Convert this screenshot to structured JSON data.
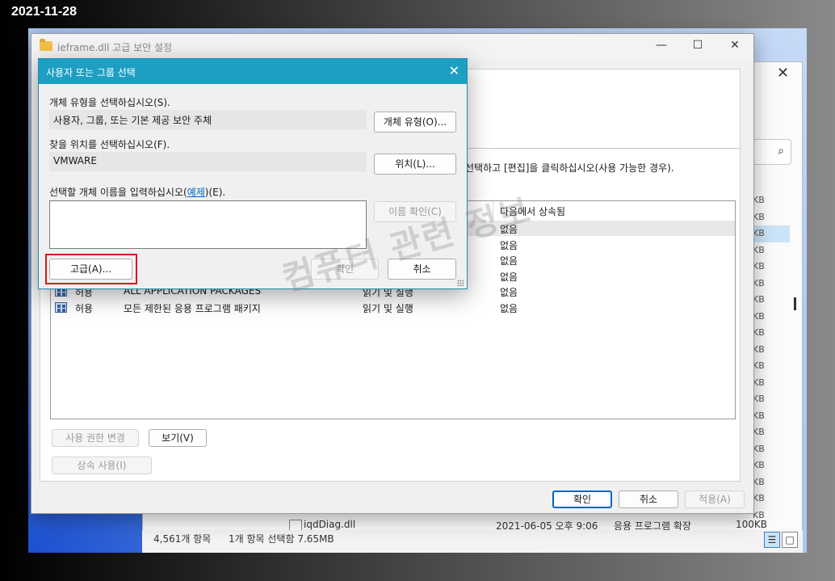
{
  "date_stamp": "2021-11-28",
  "explorer": {
    "size_column": [
      "KB",
      "KB",
      "KB",
      "KB",
      "KB",
      "KB",
      "KB",
      "KB",
      "KB",
      "KB",
      "KB",
      "KB",
      "KB",
      "KB",
      "KB",
      "KB",
      "KB",
      "KB",
      "KB",
      "KB"
    ],
    "last_row": {
      "name": "iqdDiag.dll",
      "date": "2021-06-05 오후 9:06",
      "type": "응용 프로그램 확장",
      "size": "100KB"
    },
    "status_count": "4,561개 항목",
    "status_selection": "1개 항목 선택함 7.65MB",
    "search_icon": "search-icon"
  },
  "security_window": {
    "title": "ieframe.dll 고급 보안 설정",
    "hint": "선택하고 [편집]을 클릭하십시오(사용 가능한 경우).",
    "table": {
      "inherited_header": "다음에서 상속됨",
      "rows": [
        {
          "type": "",
          "principal": "",
          "access": "",
          "inherited": "없음",
          "selected": true
        },
        {
          "type": "",
          "principal": "",
          "access": "",
          "inherited": "없음"
        },
        {
          "type": "",
          "principal": "",
          "access": "",
          "inherited": "없음"
        },
        {
          "type": "",
          "principal": "",
          "access": "",
          "inherited": "없음"
        },
        {
          "type": "허용",
          "principal": "ALL APPLICATION PACKAGES",
          "access": "읽기 및 실행",
          "inherited": "없음"
        },
        {
          "type": "허용",
          "principal": "모든 제한된 응용 프로그램 패키지",
          "access": "읽기 및 실행",
          "inherited": "없음"
        }
      ]
    },
    "buttons": {
      "change_permissions": "사용 권한 변경",
      "view": "보기(V)",
      "enable_inheritance": "상속 사용(I)",
      "ok": "확인",
      "cancel": "취소",
      "apply": "적용(A)"
    }
  },
  "select_dialog": {
    "title": "사용자 또는 그룹 선택",
    "object_type_label": "개체 유형을 선택하십시오(S).",
    "object_type_value": "사용자, 그룹, 또는 기본 제공 보안 주체",
    "object_type_button": "개체 유형(O)...",
    "location_label": "찾을 위치를 선택하십시오(F).",
    "location_value": "VMWARE",
    "location_button": "위치(L)...",
    "names_label_prefix": "선택할 개체 이름을 입력하십시오(",
    "names_label_link": "예제",
    "names_label_suffix": ")(E).",
    "check_names_button": "이름 확인(C)",
    "advanced_button": "고급(A)...",
    "ok_button": "확인",
    "cancel_button": "취소"
  },
  "watermark": "컴퓨터 관련 정보"
}
